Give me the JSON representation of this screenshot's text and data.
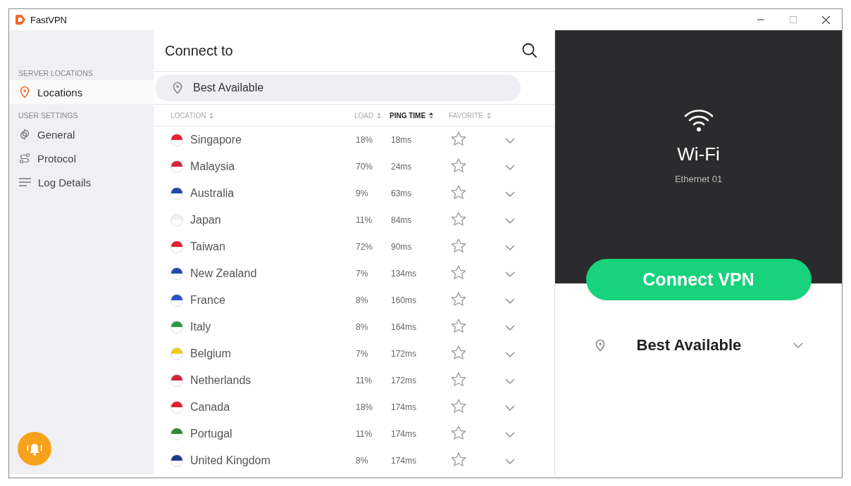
{
  "window": {
    "title": "FastVPN"
  },
  "sidebar": {
    "sections": [
      {
        "label": "SERVER LOCATIONS",
        "items": [
          {
            "label": "Locations",
            "kind": "pin",
            "selected": true
          }
        ]
      },
      {
        "label": "USER SETTINGS",
        "items": [
          {
            "label": "General",
            "kind": "gear",
            "selected": false
          },
          {
            "label": "Protocol",
            "kind": "route",
            "selected": false
          },
          {
            "label": "Log Details",
            "kind": "lines",
            "selected": false
          }
        ]
      }
    ]
  },
  "server_list": {
    "title": "Connect to",
    "best": "Best Available",
    "columns": [
      {
        "label": "LOCATION",
        "sorted": false
      },
      {
        "label": "LOAD",
        "sorted": false
      },
      {
        "label": "PING TIME",
        "sorted": true
      },
      {
        "label": "FAVORITE",
        "sorted": false
      }
    ],
    "rows": [
      {
        "name": "Singapore",
        "load": "18%",
        "ping": "18ms",
        "favorite": false,
        "color": "#e8202e"
      },
      {
        "name": "Malaysia",
        "load": "70%",
        "ping": "24ms",
        "favorite": false,
        "color": "#d6283a"
      },
      {
        "name": "Australia",
        "load": "9%",
        "ping": "63ms",
        "favorite": false,
        "color": "#1f4aa8"
      },
      {
        "name": "Japan",
        "load": "11%",
        "ping": "84ms",
        "favorite": false,
        "color": "#f2f2f2"
      },
      {
        "name": "Taiwan",
        "load": "72%",
        "ping": "90ms",
        "favorite": false,
        "color": "#e0202e"
      },
      {
        "name": "New Zealand",
        "load": "7%",
        "ping": "134ms",
        "favorite": false,
        "color": "#1f4aa8"
      },
      {
        "name": "France",
        "load": "8%",
        "ping": "160ms",
        "favorite": false,
        "color": "#2456c8"
      },
      {
        "name": "Italy",
        "load": "8%",
        "ping": "164ms",
        "favorite": false,
        "color": "#2e9a48"
      },
      {
        "name": "Belgium",
        "load": "7%",
        "ping": "172ms",
        "favorite": false,
        "color": "#f4c81c"
      },
      {
        "name": "Netherlands",
        "load": "11%",
        "ping": "172ms",
        "favorite": false,
        "color": "#c8283a"
      },
      {
        "name": "Canada",
        "load": "18%",
        "ping": "174ms",
        "favorite": false,
        "color": "#e0202e"
      },
      {
        "name": "Portugal",
        "load": "11%",
        "ping": "174ms",
        "favorite": false,
        "color": "#2e8a3a"
      },
      {
        "name": "United Kingdom",
        "load": "8%",
        "ping": "174ms",
        "favorite": false,
        "color": "#1f3a8a"
      }
    ]
  },
  "connection": {
    "network": "Wi-Fi",
    "adapter": "Ethernet 01",
    "button": "Connect VPN",
    "location": "Best Available"
  }
}
